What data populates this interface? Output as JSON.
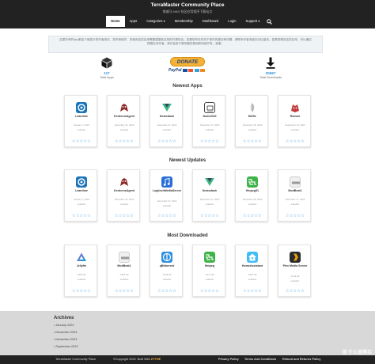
{
  "header": {
    "title": "TerraMaster Community Place",
    "subtitle": "铁威马 NAS 社区应用程序下载站点"
  },
  "nav": {
    "items": [
      {
        "label": "Home",
        "active": true
      },
      {
        "label": "Apps"
      },
      {
        "label": "Categories ▾"
      },
      {
        "label": "Membership"
      },
      {
        "label": "Dashboard"
      },
      {
        "label": "Login"
      },
      {
        "label": "Support ▾"
      }
    ],
    "search_icon": "search-icon"
  },
  "intro": {
    "text": "这里所有的app都由下面显示的作者测试、发布和维护，您使用这些应用需要遵循各应用的开源协议。如果您有任何关于软件的建议和问题，请联系作者或者在论坛留言。如果您喜欢这些应用，可以通过捐赠支持作者，我们会用于服务器的费用和持续开发，谢谢。"
  },
  "stats": {
    "total_apps": {
      "value": "117",
      "label": "Total Apps",
      "icon": "box-icon"
    },
    "total_downloads": {
      "value": "20697",
      "label": "Total Downloads",
      "icon": "download-icon"
    }
  },
  "donate": {
    "label": "DONATE",
    "paypal": "PayPal"
  },
  "sections": {
    "newest_apps": {
      "title": "Newest Apps",
      "cards": [
        {
          "name": "Leantime",
          "date": "January 7, 2024",
          "author": "sutiashri",
          "stars": "☆☆☆☆☆"
        },
        {
          "name": "KerberosAgent",
          "date": "December 31, 2023",
          "author": "sutiashri",
          "stars": "☆☆☆☆☆"
        },
        {
          "name": "Noisedash",
          "date": "November 27, 2023",
          "author": "sutiashri",
          "stars": "☆☆☆☆☆"
        },
        {
          "name": "Node2020",
          "date": "November 27, 2023",
          "author": "sutiashri",
          "stars": "☆☆☆☆☆"
        },
        {
          "name": "MUSL",
          "date": "November 25, 2023",
          "author": "sutiashri",
          "stars": "☆☆☆☆☆"
        },
        {
          "name": "Romarr",
          "date": "September 19, 2023",
          "author": "sutiashri",
          "stars": "☆☆☆☆☆"
        }
      ]
    },
    "newest_updates": {
      "title": "Newest Updates",
      "cards": [
        {
          "name": "Leantime",
          "date": "January 7, 2024",
          "author": "sutiashri",
          "stars": "☆☆☆☆☆"
        },
        {
          "name": "KerberosAgent",
          "date": "December 31, 2023",
          "author": "sutiashri",
          "stars": "☆☆☆☆☆"
        },
        {
          "name": "LogitechMediaServer",
          "date": "December 27, 2023",
          "author": "sutiashri",
          "stars": "☆☆☆☆☆"
        },
        {
          "name": "Noisedash",
          "date": "December 27, 2023",
          "author": "sutiashri",
          "stars": "☆☆☆☆☆"
        },
        {
          "name": "ffmpeg51",
          "date": "December 25, 2023",
          "author": "sutiashri",
          "stars": "☆☆☆☆☆"
        },
        {
          "name": "ModBeat1",
          "date": "December 17, 2023",
          "author": "sutiashri",
          "stars": "☆☆☆☆☆"
        }
      ]
    },
    "most_downloaded": {
      "title": "Most Downloaded",
      "cards": [
        {
          "name": "Jellyfin",
          "date": "2,469 dls",
          "author": "sutiashri",
          "stars": "☆☆☆☆☆"
        },
        {
          "name": "ModBeat1",
          "date": "1,891 dls",
          "author": "sutiashri",
          "stars": "☆☆☆☆☆"
        },
        {
          "name": "qBittorrent",
          "date": "1,578 dls",
          "author": "sutiashri",
          "stars": "☆☆☆☆☆"
        },
        {
          "name": "ffmpeg",
          "date": "1,317 dls",
          "author": "sutiashri",
          "stars": "☆☆☆☆☆"
        },
        {
          "name": "HomeAssistant",
          "date": "1,097 dls",
          "author": "sutiashri",
          "stars": "☆☆☆☆☆"
        },
        {
          "name": "Plex Media Server",
          "date": "1,043 dls",
          "author": "sutiashri",
          "stars": "☆☆☆☆☆"
        }
      ]
    }
  },
  "archives": {
    "title": "Archives",
    "items": [
      "January 2024",
      "December 2023",
      "November 2023",
      "September 2023"
    ]
  },
  "footer": {
    "site": "TerraMaster Community Place",
    "copyright": "©Copyright 2023. Built With",
    "builder": "ZYTHE",
    "privacy": "Privacy Policy",
    "terms": "Terms And Conditions",
    "refund": "Refund and Returns Policy"
  },
  "watermark": "值 什么值得买",
  "colors": {
    "accent": "#2a8fd8",
    "header_bg": "#222222",
    "archives_bg": "#d8d8d8",
    "donate": "#f6b236"
  }
}
